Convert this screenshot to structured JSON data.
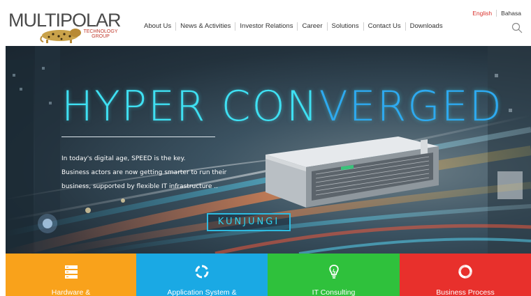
{
  "logo": {
    "name": "MULTIPOLAR",
    "sub_line1": "TECHNOLOGY",
    "sub_line2": "GROUP"
  },
  "nav": [
    {
      "label": "About Us"
    },
    {
      "label": "News & Activities"
    },
    {
      "label": "Investor Relations"
    },
    {
      "label": "Career"
    },
    {
      "label": "Solutions"
    },
    {
      "label": "Contact Us"
    },
    {
      "label": "Downloads"
    }
  ],
  "language": {
    "english": "English",
    "bahasa": "Bahasa",
    "active_color": "#d9302b"
  },
  "search": {
    "icon": "search-icon"
  },
  "hero": {
    "title_part1": "HYPER CON",
    "title_part2": "VERGED",
    "lines": [
      "In today's digital age, SPEED is the key.",
      "Business actors are now getting smarter to run their",
      "business, supported by flexible IT infrastructure .."
    ],
    "button_label": "KUNJUNGI",
    "accent_color": "#2ed4f0"
  },
  "tiles": [
    {
      "label": "Hardware &",
      "color": "#f9a21b",
      "icon": "server-icon"
    },
    {
      "label": "Application System &",
      "color": "#1aa9e4",
      "icon": "cycle-icon"
    },
    {
      "label": "IT Consulting",
      "color": "#2fc13c",
      "icon": "lightbulb-icon"
    },
    {
      "label": "Business Process",
      "color": "#e8302c",
      "icon": "process-cycle-icon"
    }
  ]
}
